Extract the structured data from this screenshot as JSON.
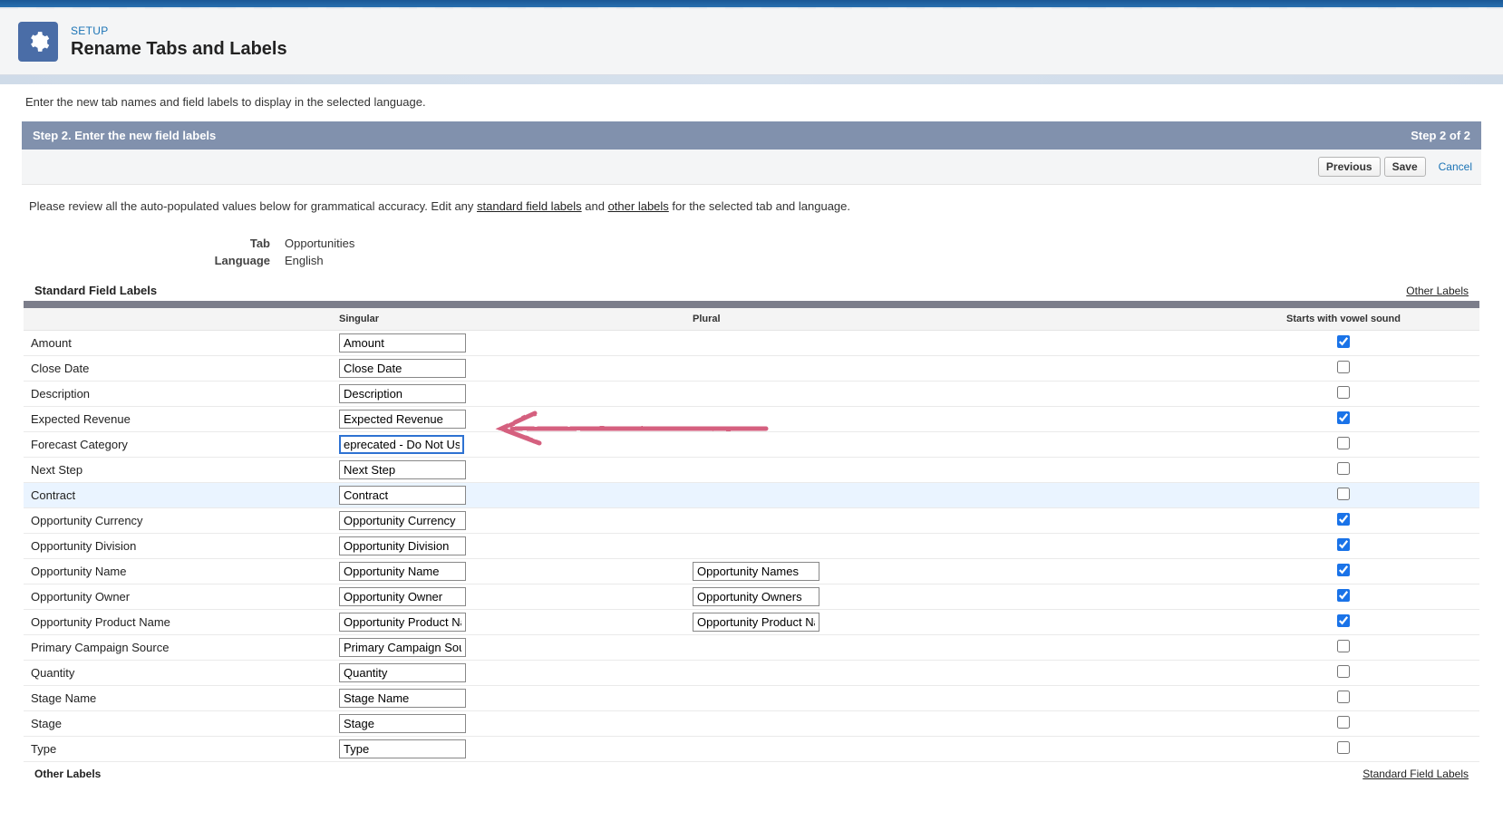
{
  "header": {
    "eyebrow": "SETUP",
    "title": "Rename Tabs and Labels"
  },
  "intro": "Enter the new tab names and field labels to display in the selected language.",
  "step": {
    "title": "Step 2. Enter the new field labels",
    "indicator": "Step 2 of 2"
  },
  "buttons": {
    "previous": "Previous",
    "save": "Save",
    "cancel": "Cancel"
  },
  "review": {
    "text_before": "Please review all the auto-populated values below for grammatical accuracy. Edit any ",
    "link1": "standard field labels",
    "text_mid": " and ",
    "link2": "other labels",
    "text_after": " for the selected tab and language."
  },
  "meta": {
    "tab_label": "Tab",
    "tab_value": "Opportunities",
    "lang_label": "Language",
    "lang_value": "English"
  },
  "section": {
    "title": "Standard Field Labels",
    "link": "Other Labels"
  },
  "columns": {
    "singular": "Singular",
    "plural": "Plural",
    "vowel": "Starts with vowel sound"
  },
  "fields": [
    {
      "label": "Amount",
      "singular": "Amount",
      "plural": "",
      "vowel": true,
      "highlight": false
    },
    {
      "label": "Close Date",
      "singular": "Close Date",
      "plural": "",
      "vowel": false,
      "highlight": false
    },
    {
      "label": "Description",
      "singular": "Description",
      "plural": "",
      "vowel": false,
      "highlight": false
    },
    {
      "label": "Expected Revenue",
      "singular": "Expected Revenue",
      "plural": "",
      "vowel": true,
      "highlight": false
    },
    {
      "label": "Forecast Category",
      "singular": "eprecated - Do Not Use)",
      "plural": "",
      "vowel": false,
      "highlight": false,
      "focused": true
    },
    {
      "label": "Next Step",
      "singular": "Next Step",
      "plural": "",
      "vowel": false,
      "highlight": false
    },
    {
      "label": "Contract",
      "singular": "Contract",
      "plural": "",
      "vowel": false,
      "highlight": true
    },
    {
      "label": "Opportunity Currency",
      "singular": "Opportunity Currency",
      "plural": "",
      "vowel": true,
      "highlight": false
    },
    {
      "label": "Opportunity Division",
      "singular": "Opportunity Division",
      "plural": "",
      "vowel": true,
      "highlight": false
    },
    {
      "label": "Opportunity Name",
      "singular": "Opportunity Name",
      "plural": "Opportunity Names",
      "vowel": true,
      "highlight": false
    },
    {
      "label": "Opportunity Owner",
      "singular": "Opportunity Owner",
      "plural": "Opportunity Owners",
      "vowel": true,
      "highlight": false
    },
    {
      "label": "Opportunity Product Name",
      "singular": "Opportunity Product Name",
      "plural": "Opportunity Product Names",
      "vowel": true,
      "highlight": false
    },
    {
      "label": "Primary Campaign Source",
      "singular": "Primary Campaign Source",
      "plural": "",
      "vowel": false,
      "highlight": false
    },
    {
      "label": "Quantity",
      "singular": "Quantity",
      "plural": "",
      "vowel": false,
      "highlight": false
    },
    {
      "label": "Stage Name",
      "singular": "Stage Name",
      "plural": "",
      "vowel": false,
      "highlight": false
    },
    {
      "label": "Stage",
      "singular": "Stage",
      "plural": "",
      "vowel": false,
      "highlight": false
    },
    {
      "label": "Type",
      "singular": "Type",
      "plural": "",
      "vowel": false,
      "highlight": false
    }
  ],
  "bottom": {
    "left": "Other Labels",
    "right": "Standard Field Labels"
  }
}
